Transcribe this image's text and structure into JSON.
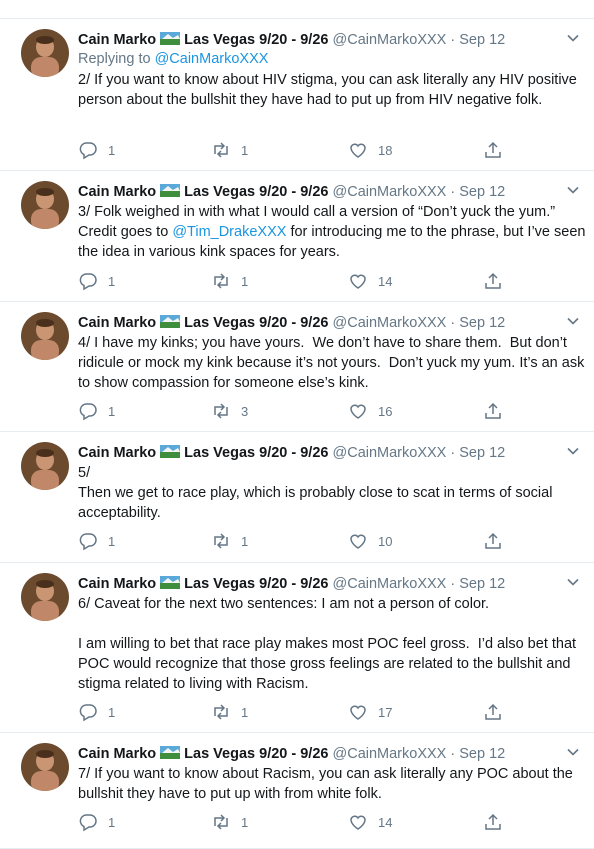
{
  "tweets": [
    {
      "name": "Cain Marko",
      "location": "Las Vegas 9/20 - 9/26",
      "handle": "@CainMarkoXXX",
      "dot": "·",
      "date": "Sep 12",
      "reply_prefix": "Replying to ",
      "reply_to": "@CainMarkoXXX",
      "text": "2/ If you want to know about HIV stigma, you can ask literally any HIV positive person about the bullshit they have had to put up from HIV negative folk.",
      "replies": "1",
      "retweets": "1",
      "likes": "18"
    },
    {
      "name": "Cain Marko",
      "location": "Las Vegas 9/20 - 9/26",
      "handle": "@CainMarkoXXX",
      "dot": "·",
      "date": "Sep 12",
      "text_a": "3/ Folk weighed in with what I would call a version of “Don’t yuck the yum.” Credit goes to ",
      "mention": "@Tim_DrakeXXX",
      "text_b": " for introducing me to the phrase, but I’ve seen the idea in various kink spaces for years.",
      "replies": "1",
      "retweets": "1",
      "likes": "14"
    },
    {
      "name": "Cain Marko",
      "location": "Las Vegas 9/20 - 9/26",
      "handle": "@CainMarkoXXX",
      "dot": "·",
      "date": "Sep 12",
      "text": "4/ I have my kinks; you have yours.  We don’t have to share them.  But don’t ridicule or mock my kink because it’s not yours.  Don’t yuck my yum. It’s an ask to show compassion for someone else’s kink.",
      "replies": "1",
      "retweets": "3",
      "likes": "16"
    },
    {
      "name": "Cain Marko",
      "location": "Las Vegas 9/20 - 9/26",
      "handle": "@CainMarkoXXX",
      "dot": "·",
      "date": "Sep 12",
      "text": "5/\nThen we get to race play, which is probably close to scat in terms of social acceptability.",
      "replies": "1",
      "retweets": "1",
      "likes": "10"
    },
    {
      "name": "Cain Marko",
      "location": "Las Vegas 9/20 - 9/26",
      "handle": "@CainMarkoXXX",
      "dot": "·",
      "date": "Sep 12",
      "text": "6/ Caveat for the next two sentences: I am not a person of color.\n\nI am willing to bet that race play makes most POC feel gross.  I’d also bet that POC would recognize that those gross feelings are related to the bullshit and stigma related to living with Racism.",
      "replies": "1",
      "retweets": "1",
      "likes": "17"
    },
    {
      "name": "Cain Marko",
      "location": "Las Vegas 9/20 - 9/26",
      "handle": "@CainMarkoXXX",
      "dot": "·",
      "date": "Sep 12",
      "text": "7/ If you want to know about Racism, you can ask literally any POC about the bullshit they have to put up with from white folk.",
      "replies": "1",
      "retweets": "1",
      "likes": "14"
    }
  ],
  "icons": {
    "reply": "reply-icon",
    "retweet": "retweet-icon",
    "like": "heart-icon",
    "share": "share-icon",
    "caret": "chevron-down-icon",
    "flag": "flag-icon"
  },
  "colors": {
    "text": "#14171a",
    "secondary": "#657786",
    "link": "#1b95e0",
    "divider": "#e6ecf0"
  }
}
